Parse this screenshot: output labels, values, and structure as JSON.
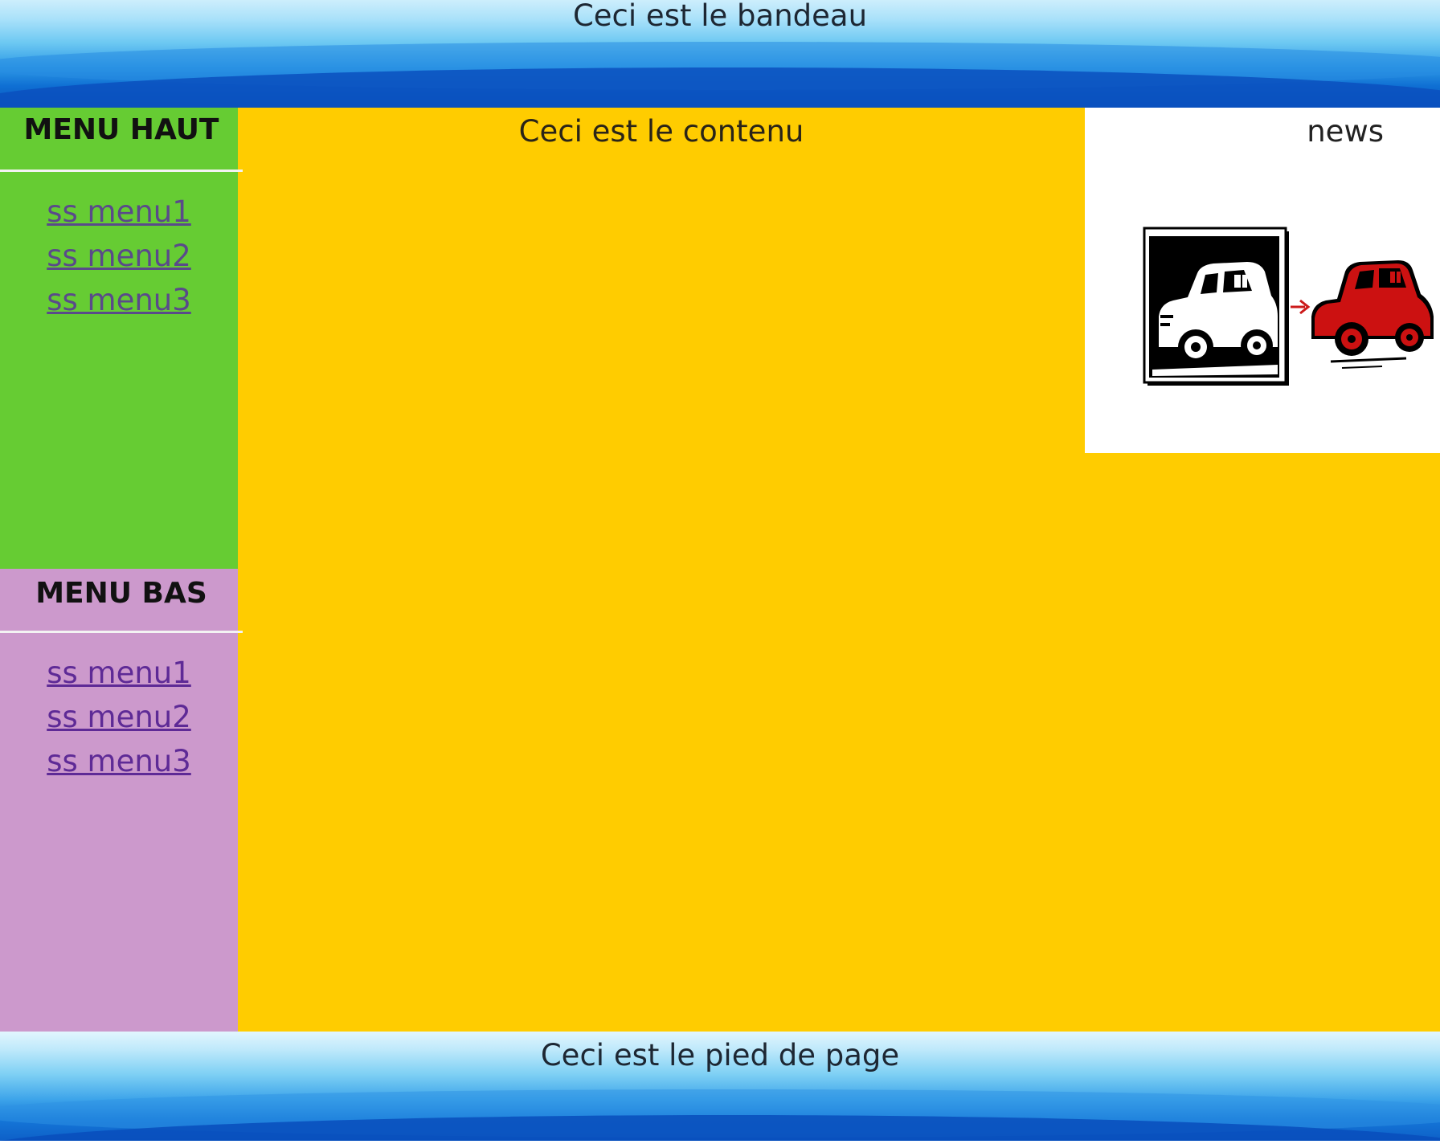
{
  "banner": {
    "title": "Ceci est le bandeau"
  },
  "menu_haut": {
    "heading": "MENU HAUT",
    "items": [
      {
        "label": "ss menu1"
      },
      {
        "label": "ss menu2"
      },
      {
        "label": "ss menu3"
      }
    ],
    "background": "#66cc33"
  },
  "menu_bas": {
    "heading": "MENU BAS",
    "items": [
      {
        "label": "ss menu1"
      },
      {
        "label": "ss menu2"
      },
      {
        "label": "ss menu3"
      }
    ],
    "background": "#cc99cc"
  },
  "content": {
    "title": "Ceci est le contenu",
    "background": "#ffcc00"
  },
  "news": {
    "title": "news",
    "image": "vintage-car-transform-icon"
  },
  "footer": {
    "title": "Ceci est le pied de page"
  }
}
